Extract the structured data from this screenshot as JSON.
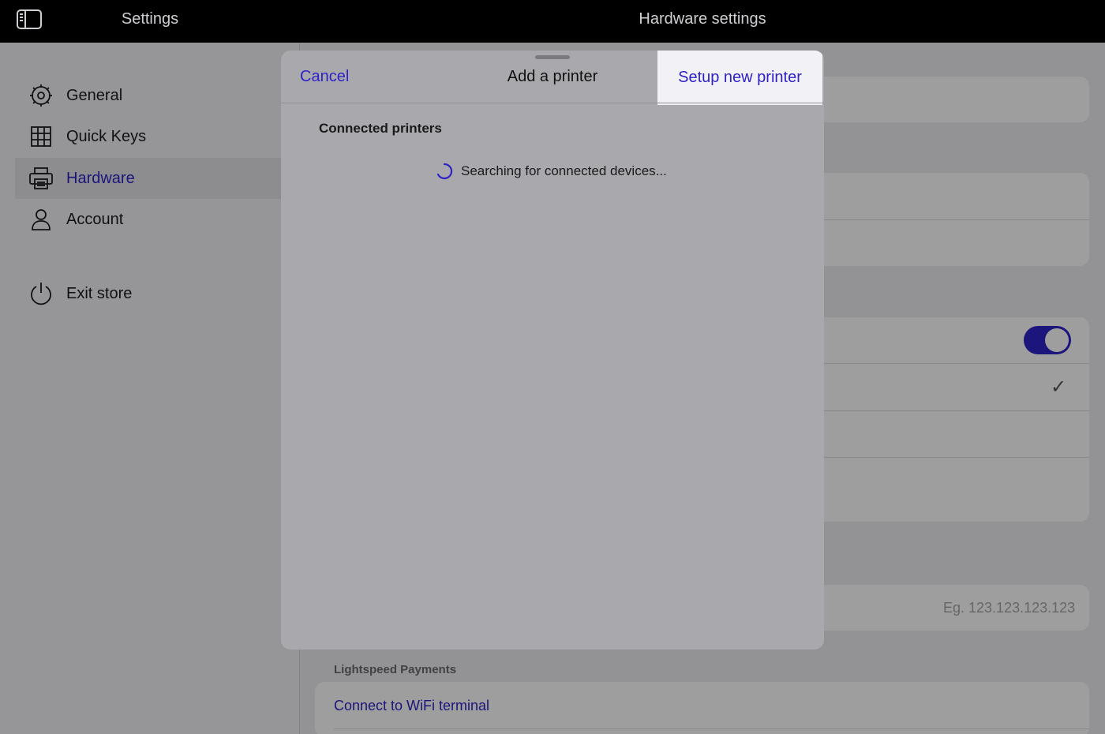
{
  "topbar": {
    "left_title": "Settings",
    "right_title": "Hardware settings"
  },
  "sidebar": {
    "items": [
      {
        "label": "General",
        "icon": "gear-icon"
      },
      {
        "label": "Quick Keys",
        "icon": "grid-icon"
      },
      {
        "label": "Hardware",
        "icon": "printer-icon",
        "active": true
      },
      {
        "label": "Account",
        "icon": "person-icon"
      },
      {
        "label": "Exit store",
        "icon": "power-icon"
      }
    ]
  },
  "main": {
    "ip_placeholder": "Eg. 123.123.123.123",
    "payments_label": "Lightspeed Payments",
    "wifi_link": "Connect to WiFi terminal",
    "toggle_on": true
  },
  "modal": {
    "cancel_label": "Cancel",
    "title": "Add a printer",
    "setup_label": "Setup new printer",
    "connected_label": "Connected printers",
    "searching_text": "Searching for connected devices..."
  },
  "colors": {
    "accent": "#2e22c7",
    "topbar": "#000000",
    "sidebar_bg": "#f2f2f6"
  }
}
